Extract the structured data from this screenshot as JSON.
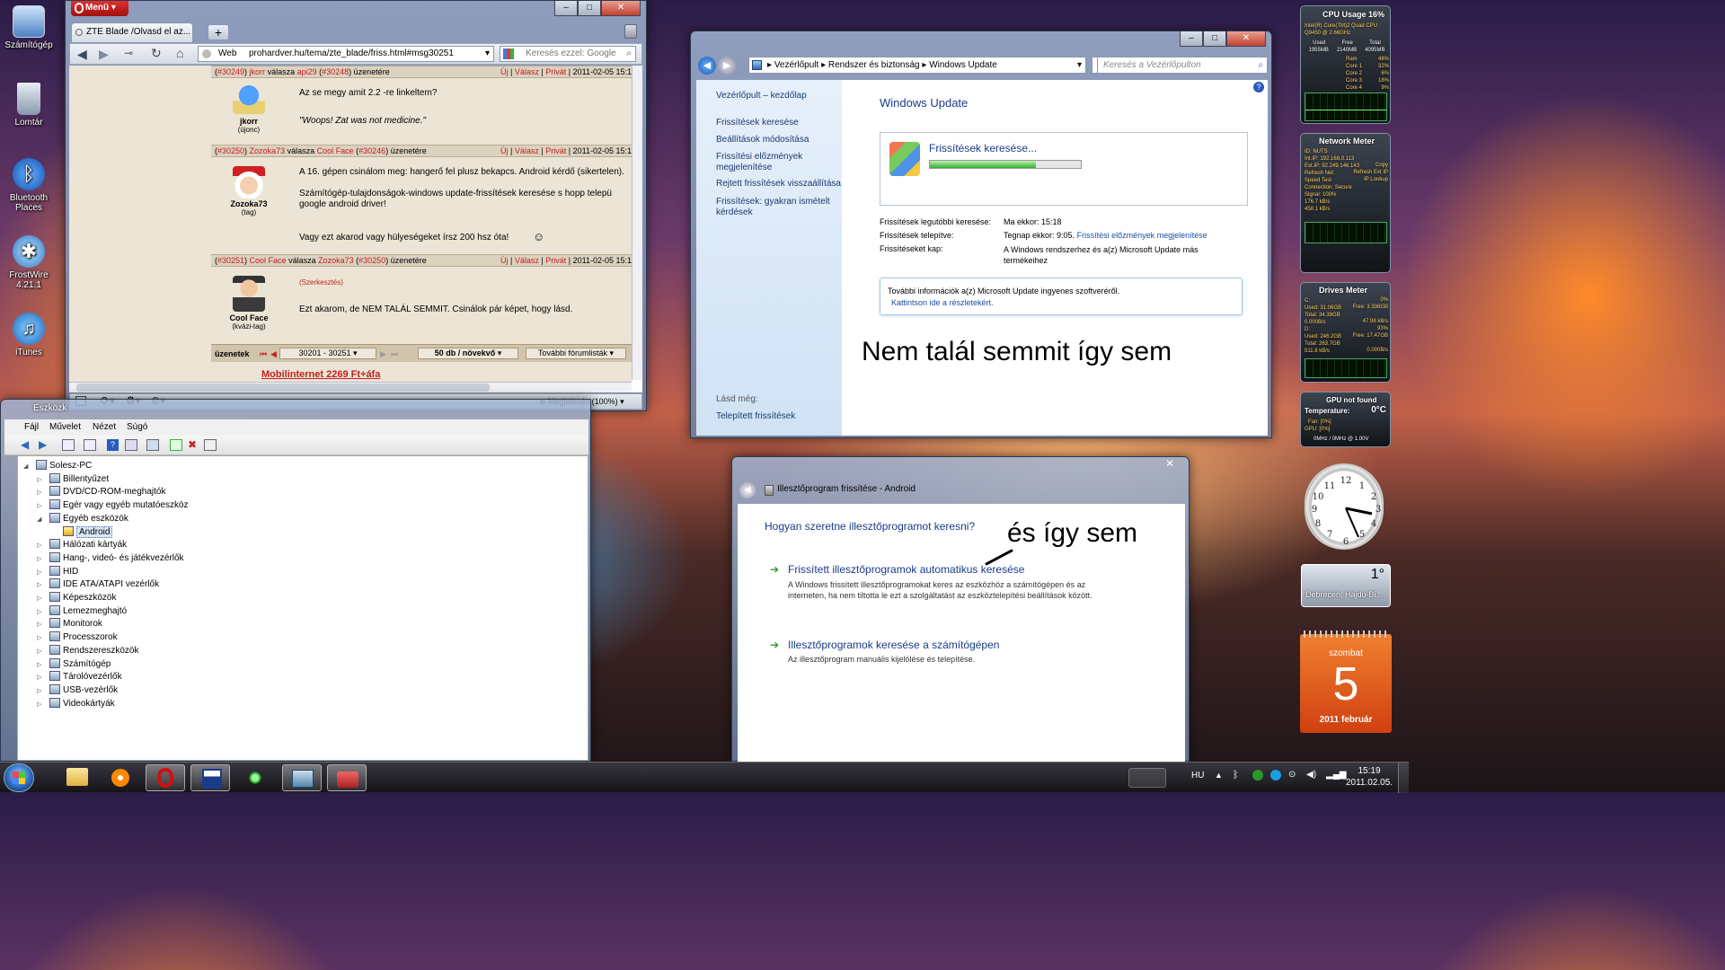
{
  "desktop": {
    "icons": [
      {
        "label": "Számítógép"
      },
      {
        "label": "Lomtár"
      },
      {
        "label": "Bluetooth Places"
      },
      {
        "label": "FrostWire 4.21.1"
      },
      {
        "label": "iTunes"
      }
    ]
  },
  "opera": {
    "menu_label": "Menü",
    "tab_title": "ZTE Blade /Olvasd el az...",
    "web_label": "Web",
    "url": "prohardver.hu/tema/zte_blade/friss.html#msg30251",
    "search_placeholder": "Keresés ezzel: Google",
    "posts": [
      {
        "num": "#30249",
        "author": "jkorr",
        "verb": "válasza",
        "to": "api29",
        "to_num": "#30248",
        "suffix": "üzenetére",
        "links": [
          "Új",
          "Válasz",
          "Privát"
        ],
        "date": "2011-02-05 15:1",
        "nick": "jkorr",
        "rank": "(újonc)",
        "lines": [
          "Az se megy amit 2.2 -re linkeltem?",
          "\"Woops! Zat was not medicine.\""
        ]
      },
      {
        "num": "#30250",
        "author": "Zozoka73",
        "verb": "válasza",
        "to": "Cool Face",
        "to_num": "#30246",
        "suffix": "üzenetére",
        "links": [
          "Új",
          "Válasz",
          "Privát"
        ],
        "date": "2011-02-05 15:1",
        "nick": "Zozoka73",
        "rank": "(tag)",
        "lines": [
          "A 16. gépen csinálom meg: hangerő fel plusz bekapcs. Android kérdő (sikertelen).",
          "Számítógép-tulajdonságok-windows update-frissítések keresése s hopp telepü google android driver!",
          "Vagy ezt akarod vagy hülyeségeket írsz 200 hsz óta!"
        ]
      },
      {
        "num": "#30251",
        "author": "Cool Face",
        "verb": "válasza",
        "to": "Zozoka73",
        "to_num": "#30250",
        "suffix": "üzenetére",
        "links": [
          "Új",
          "Válasz",
          "Privát"
        ],
        "date": "2011-02-05 15:1",
        "nick": "Cool Face",
        "rank": "(kvázi-tag)",
        "edit_note": "(Szerkesztés)",
        "lines": [
          "Ezt akarom, de NEM TALÁL SEMMIT. Csinálok pár képet, hogy lásd."
        ]
      }
    ],
    "pager": {
      "label": "üzenetek",
      "range": "30201 - 30251",
      "per_page": "50 db / növekvő",
      "more": "További fórumlisták"
    },
    "ad_text": "Mobilinternet 2269 Ft+áfa",
    "zoom_label": "Megjelenés (100%)"
  },
  "devmgr": {
    "title": "Eszközk",
    "menu": [
      "Fájl",
      "Művelet",
      "Nézet",
      "Súgó"
    ],
    "tree": [
      {
        "label": "Solesz-PC",
        "level": 0,
        "expander": "◢"
      },
      {
        "label": "Billentyűzet",
        "level": 1,
        "expander": "▷"
      },
      {
        "label": "DVD/CD-ROM-meghajtók",
        "level": 1,
        "expander": "▷"
      },
      {
        "label": "Egér vagy egyéb mutatóeszköz",
        "level": 1,
        "expander": "▷"
      },
      {
        "label": "Egyéb eszközök",
        "level": 1,
        "expander": "◢"
      },
      {
        "label": "Android",
        "level": 2,
        "expander": ""
      },
      {
        "label": "Hálózati kártyák",
        "level": 1,
        "expander": "▷"
      },
      {
        "label": "Hang-, videó- és játékvezérlők",
        "level": 1,
        "expander": "▷"
      },
      {
        "label": "HID",
        "level": 1,
        "expander": "▷"
      },
      {
        "label": "IDE ATA/ATAPI vezérlők",
        "level": 1,
        "expander": "▷"
      },
      {
        "label": "Képeszközök",
        "level": 1,
        "expander": "▷"
      },
      {
        "label": "Lemezmeghajtó",
        "level": 1,
        "expander": "▷"
      },
      {
        "label": "Monitorok",
        "level": 1,
        "expander": "▷"
      },
      {
        "label": "Processzorok",
        "level": 1,
        "expander": "▷"
      },
      {
        "label": "Rendszereszközök",
        "level": 1,
        "expander": "▷"
      },
      {
        "label": "Számítógép",
        "level": 1,
        "expander": "▷"
      },
      {
        "label": "Tárolóvezérlők",
        "level": 1,
        "expander": "▷"
      },
      {
        "label": "USB-vezérlők",
        "level": 1,
        "expander": "▷"
      },
      {
        "label": "Videokártyák",
        "level": 1,
        "expander": "▷"
      }
    ]
  },
  "wu": {
    "breadcrumb": [
      "Vezérlőpult",
      "Rendszer és biztonság",
      "Windows Update"
    ],
    "search_placeholder": "Keresés a Vezérlőpulton",
    "side_home": "Vezérlőpult – kezdőlap",
    "side_links": [
      "Frissítések keresése",
      "Beállítások módosítása",
      "Frissítési előzmények megjelenítése",
      "Rejtett frissítések visszaállítása",
      "Frissítések: gyakran ismételt kérdések"
    ],
    "see_also": "Lásd még:",
    "see_also_link": "Telepített frissítések",
    "heading": "Windows Update",
    "status": "Frissítések keresése...",
    "progress": 0.7,
    "info": [
      {
        "label": "Frissítések legutóbbi keresése:",
        "value": "Ma ekkor: 15:18",
        "link": ""
      },
      {
        "label": "Frissítések telepítve:",
        "value": "Tegnap ekkor: 9:05.",
        "link": "Frissítési előzmények megjelenítése"
      },
      {
        "label": "Frissítéseket kap:",
        "value": "A Windows rendszerhez és a(z) Microsoft Update más termékeihez",
        "link": ""
      }
    ],
    "notice": "További információk a(z) Microsoft Update ingyenes szoftveréről.",
    "notice_link": "Kattintson ide a részletekért.",
    "annotation": "Nem talál semmit így sem"
  },
  "driver": {
    "title": "Illesztőprogram frissítése - Android",
    "question": "Hogyan szeretne illesztőprogramot keresni?",
    "annotation": "és így sem",
    "opt1_title": "Frissített illesztőprogramok automatikus keresése",
    "opt1_desc": "A Windows frissített illesztőprogramokat keres az eszközhöz a számítógépen és az interneten, ha nem tiltotta le ezt a szolgáltatást az eszköztelepítési beállítások között.",
    "opt2_title": "Illesztőprogramok keresése a számítógépen",
    "opt2_desc": "Az illesztőprogram manuális kijelölése és telepítése."
  },
  "gadgets": {
    "cpu": {
      "title": "CPU Usage",
      "pct": "16%",
      "model": "Intel(R) Core(TM)2 Quad CPU Q9450 @ 2.66GHz",
      "mem_hdr": [
        "Used",
        "Free",
        "Total"
      ],
      "mem": [
        "1955MB",
        "2140MB",
        "4095MB"
      ],
      "cores": [
        {
          "name": "Ram",
          "val": "48%"
        },
        {
          "name": "Core 1",
          "val": "32%"
        },
        {
          "name": "Core 2",
          "val": "6%"
        },
        {
          "name": "Core 3",
          "val": "18%"
        },
        {
          "name": "Core 4",
          "val": "9%"
        }
      ]
    },
    "net": {
      "title": "Network Meter",
      "lines": [
        "ID: NUTS",
        "Int.IP: 192.168.0.113",
        "Ext.IP: 92.249.146.143",
        "Refresh Net",
        "Speed Test",
        "Connection: Secure",
        "Signal: 100%",
        "176.7 kB/s",
        "458.1 kB/s",
        "Current",
        "100.7 MB",
        "941.2 MB",
        "Total",
        "212.260 GB",
        "371.121 GB"
      ],
      "copy": "Copy",
      "refresh_ext": "Refresh Ext IP",
      "ip_lookup": "IP Lookup"
    },
    "drives": {
      "title": "Drives Meter",
      "lines": [
        "C:",
        "Used: 31.06GB",
        "Total: 34.39GB",
        "0.000B/s",
        "D:",
        "Used: 246.2GB",
        "Total: 263.7GB",
        "511.8 kB/s"
      ],
      "c_pct": "0%",
      "c_free": "Free: 3.336GB",
      "c_rate": "47.98 kB/s",
      "d_pct": "93%",
      "d_free": "Free: 17.47GB",
      "d_rate": "0.000B/s"
    },
    "gpu": {
      "title": "GPU not found",
      "temp_label": "Temperature:",
      "temp": "0°C",
      "fan": "Fan: [0%]",
      "gpu": "GPU: [0%]",
      "clock": "0MHz / 0MHz @ 1.00V"
    },
    "weather": {
      "temp": "1°",
      "city": "Debrecen, Hajdu-Bi..."
    },
    "calendar": {
      "weekday": "szombat",
      "day": "5",
      "month": "2011 február"
    }
  },
  "taskbar": {
    "lang": "HU",
    "time": "15:19",
    "date": "2011.02.05."
  }
}
